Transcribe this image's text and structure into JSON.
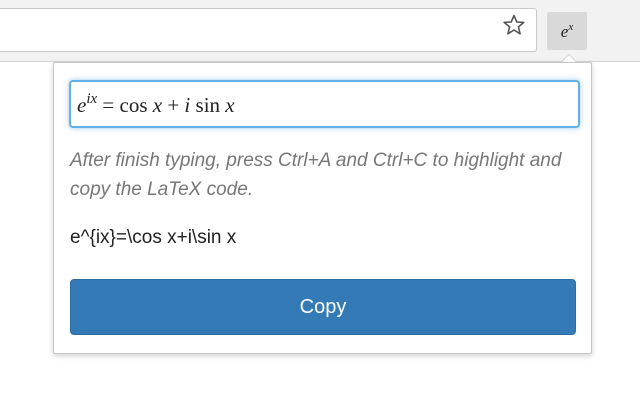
{
  "browser": {
    "star_icon": "star-outline-icon",
    "extension_button": {
      "base": "e",
      "superscript": "x"
    }
  },
  "popup": {
    "math_input": {
      "base": "e",
      "exponent": "ix",
      "rest_before_i": " = cos ",
      "x1": "x",
      "plus": " + ",
      "i": "i",
      "sin": " sin ",
      "x2": "x"
    },
    "hint": "After finish typing, press Ctrl+A and Ctrl+C to highlight and copy the LaTeX code.",
    "latex_code": "e^{ix}=\\cos x+i\\sin x",
    "copy_label": "Copy"
  },
  "colors": {
    "primary_button": "#337ab7",
    "focus_border": "#66afe9",
    "hint_text": "#777777"
  }
}
